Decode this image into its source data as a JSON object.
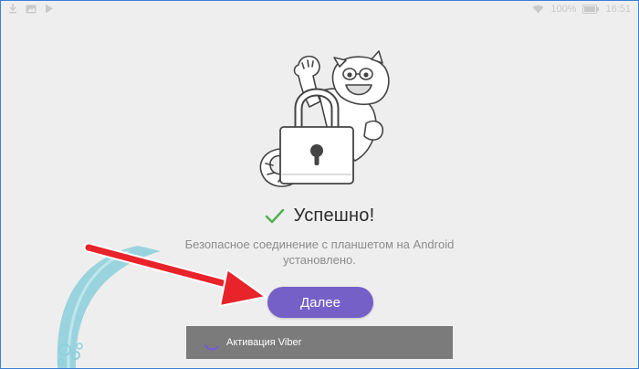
{
  "status_bar": {
    "battery_text": "100%",
    "time": "16:51"
  },
  "main": {
    "success_title": "Успешно!",
    "description_line1": "Безопасное соединение с планшетом на Android",
    "description_line2": "установлено.",
    "next_button_label": "Далее"
  },
  "toast": {
    "text": "Активация Viber"
  },
  "colors": {
    "accent": "#7560c8",
    "success_check": "#4caf50",
    "annotation_arrow": "#e8232a",
    "swoosh": "#7ec8d6"
  }
}
